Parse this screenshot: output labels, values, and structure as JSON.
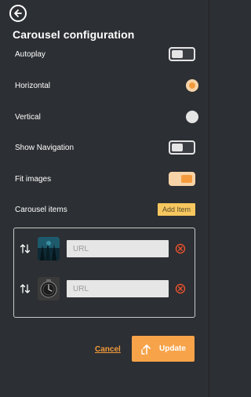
{
  "header": {
    "title": "Carousel configuration"
  },
  "settings": {
    "autoplay": {
      "label": "Autoplay",
      "state": "off"
    },
    "horizontal": {
      "label": "Horizontal",
      "selected": true
    },
    "vertical": {
      "label": "Vertical",
      "selected": false
    },
    "show_navigation": {
      "label": "Show Navigation",
      "state": "off"
    },
    "fit_images": {
      "label": "Fit images",
      "state": "on"
    }
  },
  "items_section": {
    "label": "Carousel items",
    "add_label": "Add Item"
  },
  "items": [
    {
      "url_placeholder": "URL",
      "url_value": ""
    },
    {
      "url_placeholder": "URL",
      "url_value": ""
    }
  ],
  "footer": {
    "cancel_label": "Cancel",
    "update_label": "Update"
  },
  "colors": {
    "accent": "#f39b3c",
    "accent_light": "#f7d3a8",
    "add_button": "#f7c75f",
    "remove": "#e8512e",
    "background": "#2c2f33"
  }
}
